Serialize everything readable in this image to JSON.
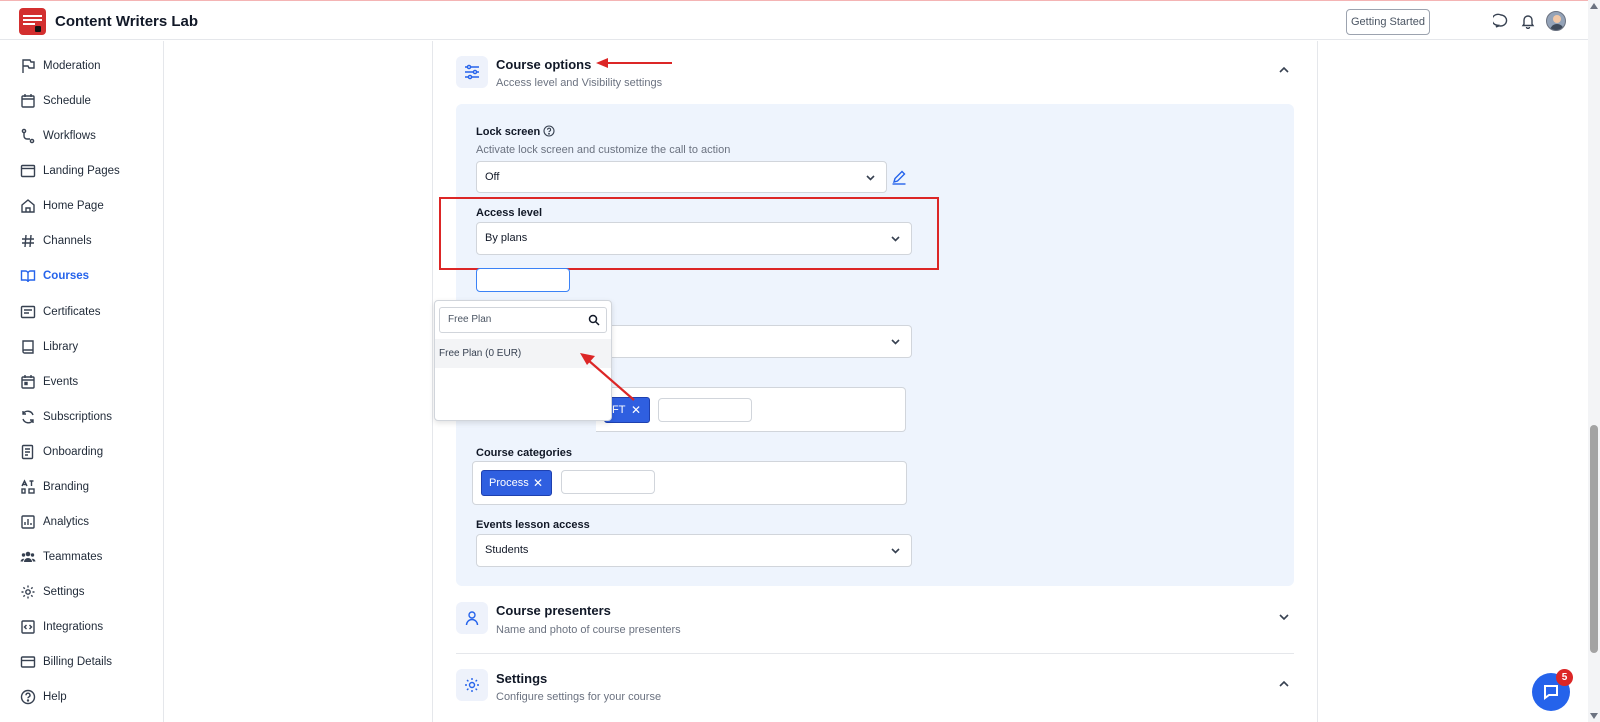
{
  "app": {
    "title": "Content Writers Lab",
    "getting_started_label": "Getting Started"
  },
  "sidebar": {
    "items": [
      {
        "label": "Moderation",
        "icon": "flag-icon"
      },
      {
        "label": "Schedule",
        "icon": "calendar-icon"
      },
      {
        "label": "Workflows",
        "icon": "workflow-icon"
      },
      {
        "label": "Landing Pages",
        "icon": "window-icon"
      },
      {
        "label": "Home Page",
        "icon": "home-icon"
      },
      {
        "label": "Channels",
        "icon": "hash-icon"
      },
      {
        "label": "Courses",
        "icon": "book-icon",
        "active": true
      },
      {
        "label": "Certificates",
        "icon": "certificate-icon"
      },
      {
        "label": "Library",
        "icon": "library-icon"
      },
      {
        "label": "Events",
        "icon": "event-icon"
      },
      {
        "label": "Subscriptions",
        "icon": "refresh-icon"
      },
      {
        "label": "Onboarding",
        "icon": "onboarding-icon"
      },
      {
        "label": "Branding",
        "icon": "branding-icon"
      },
      {
        "label": "Analytics",
        "icon": "chart-icon"
      },
      {
        "label": "Teammates",
        "icon": "users-icon"
      },
      {
        "label": "Settings",
        "icon": "gear-icon"
      },
      {
        "label": "Integrations",
        "icon": "code-icon"
      },
      {
        "label": "Billing Details",
        "icon": "card-icon"
      },
      {
        "label": "Help",
        "icon": "help-icon"
      }
    ]
  },
  "course_options": {
    "title": "Course options",
    "subtitle": "Access level and Visibility settings",
    "lock_screen": {
      "label": "Lock screen",
      "help": "Activate lock screen and customize the call to action",
      "value": "Off"
    },
    "access_level": {
      "label": "Access level",
      "value": "By plans"
    },
    "plan_dropdown": {
      "search_value": "Free Plan",
      "option": "Free Plan (0 EUR)"
    },
    "tag_fragment": "FT",
    "course_categories": {
      "label": "Course categories",
      "tag": "Process"
    },
    "events_lesson_access": {
      "label": "Events lesson access",
      "value": "Students"
    }
  },
  "course_presenters": {
    "title": "Course presenters",
    "subtitle": "Name and photo of course presenters"
  },
  "settings": {
    "title": "Settings",
    "subtitle": "Configure settings for your course"
  },
  "chat": {
    "badge_count": "5"
  },
  "colors": {
    "accent": "#2563eb",
    "annotation": "#dc2626",
    "panel_bg": "#eef4fd"
  }
}
